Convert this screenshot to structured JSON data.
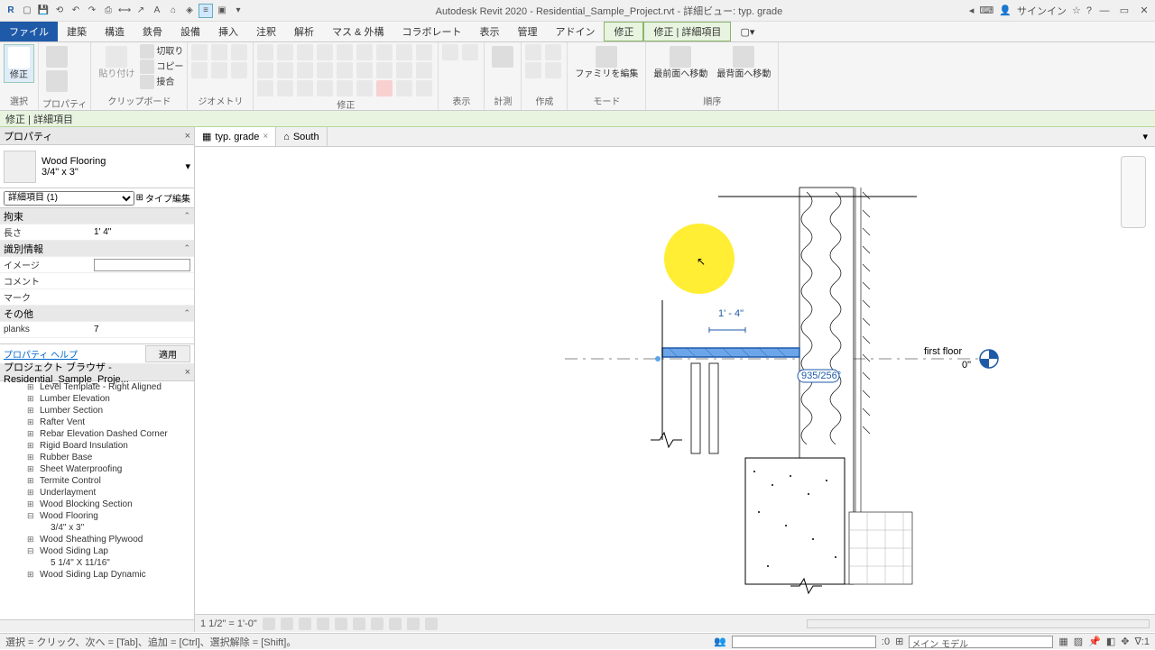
{
  "title": "Autodesk Revit 2020 - Residential_Sample_Project.rvt - 詳細ビュー: typ. grade",
  "signin": "サインイン",
  "menu": {
    "file": "ファイル",
    "arch": "建築",
    "struct": "構造",
    "steel": "鉄骨",
    "equip": "設備",
    "insert": "挿入",
    "anno": "注釈",
    "analyze": "解析",
    "mass": "マス & 外構",
    "collab": "コラボレート",
    "view": "表示",
    "manage": "管理",
    "addin": "アドイン",
    "modify": "修正",
    "detail": "修正 | 詳細項目"
  },
  "ribbon": {
    "select": {
      "modify": "修正",
      "label": "選択"
    },
    "props": {
      "props_btn": "プロパティ",
      "label": "プロパティ"
    },
    "clip": {
      "paste": "貼り付け",
      "cut": "切取り",
      "copy": "コピー",
      "match": "接合",
      "label": "クリップボード"
    },
    "geom": {
      "label": "ジオメトリ"
    },
    "mod": {
      "label": "修正"
    },
    "view": {
      "label": "表示"
    },
    "meas": {
      "label": "計測"
    },
    "create": {
      "label": "作成"
    },
    "mode": {
      "fam": "ファミリを編集",
      "label": "モード"
    },
    "order": {
      "front": "最前面へ移動",
      "back": "最背面へ移動",
      "label": "順序"
    }
  },
  "context": "修正 | 詳細項目",
  "props": {
    "header": "プロパティ",
    "type_name": "Wood Flooring",
    "type_size": "3/4\" x 3\"",
    "filter": "詳細項目 (1)",
    "edit_type": "タイプ編集",
    "constraints": "拘束",
    "length_k": "長さ",
    "length_v": "1'  4\"",
    "identity": "識別情報",
    "image_k": "イメージ",
    "image_v": "",
    "comment_k": "コメント",
    "mark_k": "マーク",
    "other": "その他",
    "planks_k": "planks",
    "planks_v": "7",
    "help": "プロパティ ヘルプ",
    "apply": "適用"
  },
  "browser": {
    "header": "プロジェクト ブラウザ - Residential_Sample_Proje...",
    "items": [
      {
        "label": "Level Template - Right Aligned"
      },
      {
        "label": "Lumber Elevation"
      },
      {
        "label": "Lumber Section"
      },
      {
        "label": "Rafter Vent"
      },
      {
        "label": "Rebar Elevation Dashed Corner"
      },
      {
        "label": "Rigid Board Insulation"
      },
      {
        "label": "Rubber Base"
      },
      {
        "label": "Sheet Waterproofing"
      },
      {
        "label": "Termite Control"
      },
      {
        "label": "Underlayment"
      },
      {
        "label": "Wood Blocking Section"
      },
      {
        "label": "Wood Flooring",
        "open": true,
        "children": [
          {
            "label": "3/4\" x 3\""
          }
        ]
      },
      {
        "label": "Wood Sheathing Plywood"
      },
      {
        "label": "Wood Siding Lap",
        "open": true,
        "children": [
          {
            "label": "5 1/4\" X 11/16\""
          }
        ]
      },
      {
        "label": "Wood Siding Lap Dynamic"
      }
    ]
  },
  "tabs": {
    "active": "typ. grade",
    "second": "South"
  },
  "drawing": {
    "dim": "1' - 4\"",
    "level": "first floor",
    "level_val": "0\"",
    "angle": "935/256°"
  },
  "viewctrl": {
    "scale": "1 1/2\" = 1'-0\""
  },
  "status": {
    "hint": "選択 = クリック、次へ = [Tab]、追加 = [Ctrl]、選択解除 = [Shift]。",
    "zoom": ":0",
    "model": "メイン モデル"
  }
}
